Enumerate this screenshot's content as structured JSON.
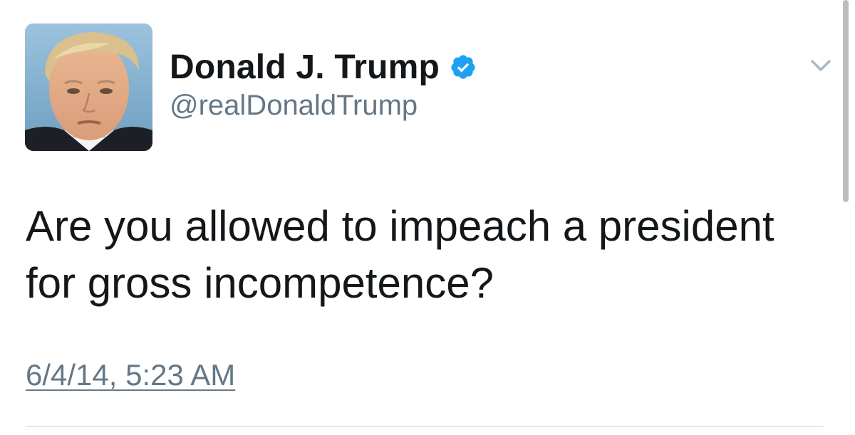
{
  "tweet": {
    "author": {
      "display_name": "Donald J. Trump",
      "handle": "@realDonaldTrump",
      "verified": true,
      "avatar_icon": "avatar-portrait"
    },
    "text": "Are you allowed to impeach a president for gross incompetence?",
    "timestamp": "6/4/14, 5:23 AM",
    "menu_icon": "chevron-down-icon"
  },
  "colors": {
    "name_text": "#14171a",
    "secondary_text": "#657786",
    "verified_badge": "#1da1f2",
    "divider": "#e1e8ed"
  }
}
